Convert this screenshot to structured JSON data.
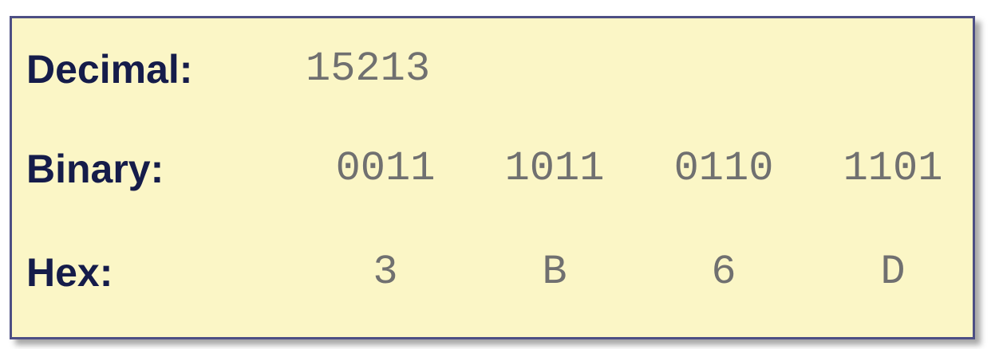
{
  "decimal": {
    "label": "Decimal:",
    "value": "15213"
  },
  "binary": {
    "label": "Binary:",
    "groups": [
      "0011",
      "1011",
      "0110",
      "1101"
    ]
  },
  "hex": {
    "label": "Hex:",
    "digits": [
      "3",
      "B",
      "6",
      "D"
    ]
  },
  "colors": {
    "panel_background": "#fbf6c6",
    "panel_border": "#4d4f84",
    "label_text": "#151c4a",
    "value_text": "#707070"
  }
}
